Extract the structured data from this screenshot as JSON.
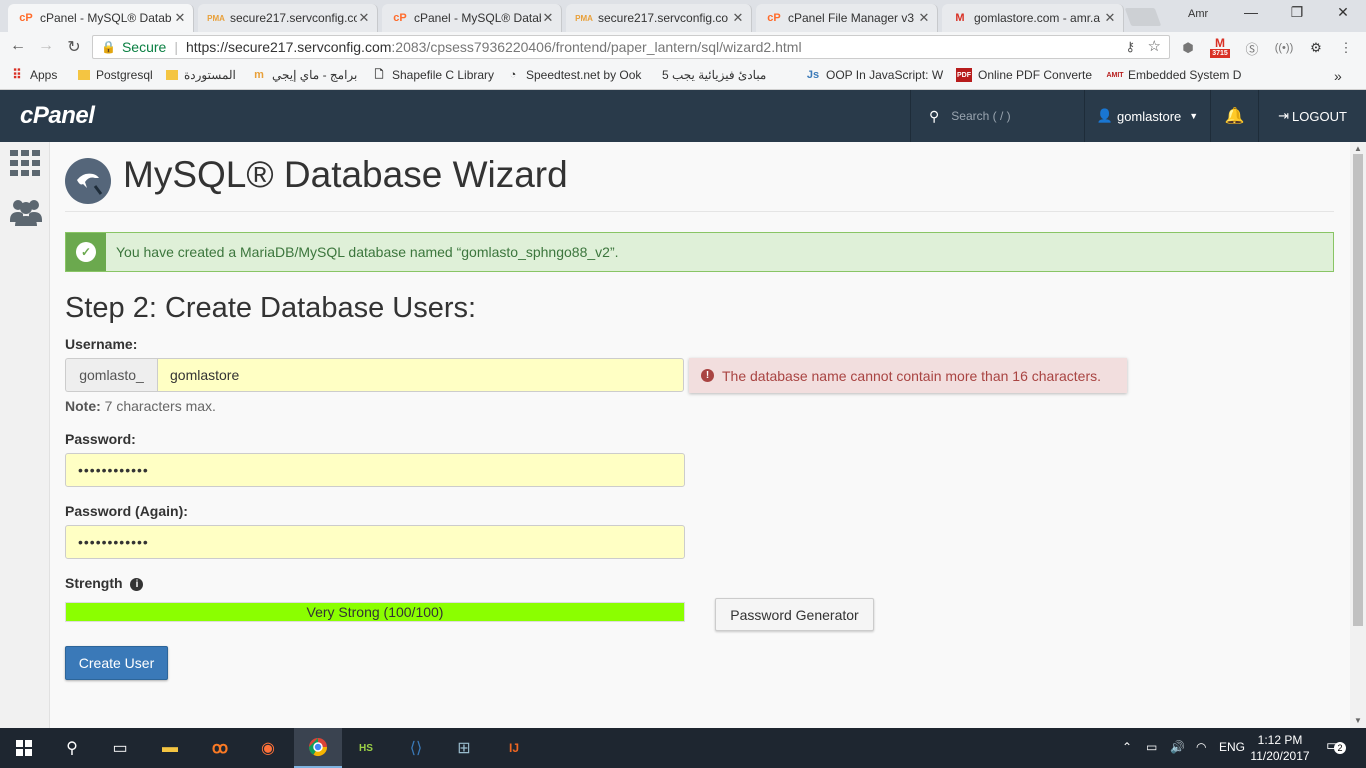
{
  "browser": {
    "tabs": [
      {
        "label": "cPanel - MySQL® Datab",
        "icon": "cpanel-icon",
        "active": true
      },
      {
        "label": "secure217.servconfig.co",
        "icon": "phpmyadmin-icon",
        "active": false
      },
      {
        "label": "cPanel - MySQL® Datab",
        "icon": "cpanel-icon",
        "active": false
      },
      {
        "label": "secure217.servconfig.co",
        "icon": "phpmyadmin-icon",
        "active": false
      },
      {
        "label": "cPanel File Manager v3",
        "icon": "cpanel-icon",
        "active": false
      },
      {
        "label": "gomlastore.com - amr.a",
        "icon": "gmail-icon",
        "active": false
      }
    ],
    "profile_name": "Amr",
    "address": {
      "secure_label": "Secure",
      "url_origin": "https://secure217.servconfig.com",
      "url_rest": ":2083/cpsess7936220406/frontend/paper_lantern/sql/wizard2.html"
    },
    "mail_badge": "3715",
    "bookmarks": [
      {
        "label": "Apps",
        "icon": "apps-grid-icon"
      },
      {
        "label": "Postgresql",
        "icon": "folder-icon"
      },
      {
        "label": "المستوردة",
        "icon": "folder-icon"
      },
      {
        "label": "برامج - ماي إيجي",
        "icon": "m-logo-icon"
      },
      {
        "label": "Shapefile C Library",
        "icon": "page-icon"
      },
      {
        "label": "Speedtest.net by Ook",
        "icon": "speedometer-icon"
      },
      {
        "label": "5 مبادئ فيزيائية يجب",
        "icon": "page-icon"
      },
      {
        "label": "OOP In JavaScript: W",
        "icon": "js-icon"
      },
      {
        "label": "Online PDF Converte",
        "icon": "pdf-icon"
      },
      {
        "label": "Embedded System D",
        "icon": "amit-icon"
      }
    ]
  },
  "cpanel": {
    "logo": "cPanel",
    "search_placeholder": "Search ( / )",
    "username": "gomlastore",
    "logout_label": "LOGOUT"
  },
  "page": {
    "title": "MySQL® Database Wizard",
    "success_message": "You have created a MariaDB/MySQL database named “gomlasto_sphngo88_v2”.",
    "step_title": "Step 2: Create Database Users:",
    "username_label": "Username:",
    "username_prefix": "gomlasto_",
    "username_value": "gomlastore",
    "error_message": "The database name cannot contain more than 16 characters.",
    "note_label": "Note:",
    "note_text": "7 characters max.",
    "password_label": "Password:",
    "password_value": "••••••••••••",
    "password_again_label": "Password (Again):",
    "password_again_value": "••••••••••••",
    "strength_label": "Strength",
    "strength_text": "Very Strong (100/100)",
    "strength_percent": 100,
    "password_generator_label": "Password Generator",
    "create_user_label": "Create User"
  },
  "taskbar": {
    "language": "ENG",
    "time": "1:12 PM",
    "date": "11/20/2017",
    "notification_count": "2"
  },
  "colors": {
    "cpanel_header": "#293a4a",
    "success_bg": "#dff0d8",
    "error_bg": "#f2dede",
    "strength_fill": "#8bff00",
    "primary_button": "#3a79b8",
    "input_autofill": "#ffffc4"
  }
}
